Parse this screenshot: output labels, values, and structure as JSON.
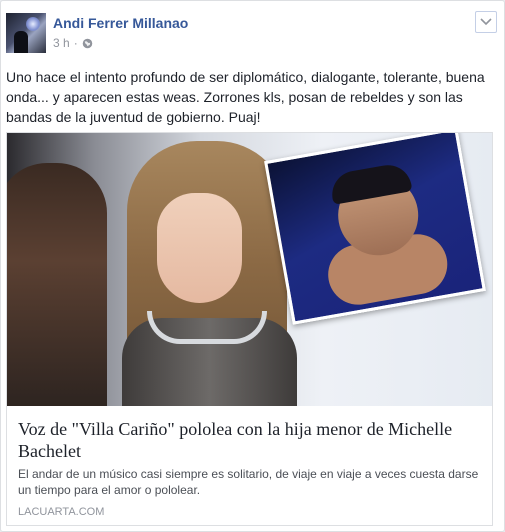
{
  "post": {
    "author": "Andi Ferrer Millanao",
    "time": "3 h",
    "separator": "·",
    "privacy_icon": "globe-icon",
    "menu_icon": "chevron-down-icon",
    "text": "Uno hace el intento profundo de ser diplomático, dialogante, tolerante, buena onda... y aparecen estas weas. Zorrones kls, posan de rebeldes y son las bandas de la juventud de gobierno. Puaj!"
  },
  "link": {
    "title": "Voz de \"Villa Cariño\" pololea con la hija menor de Michelle Bachelet",
    "description": "El andar de un músico casi siempre es solitario, de viaje en viaje a veces cuesta darse un tiempo para el amor o pololear.",
    "domain": "LACUARTA.COM"
  },
  "colors": {
    "author": "#365899",
    "text": "#1d2129",
    "muted": "#90949c"
  }
}
